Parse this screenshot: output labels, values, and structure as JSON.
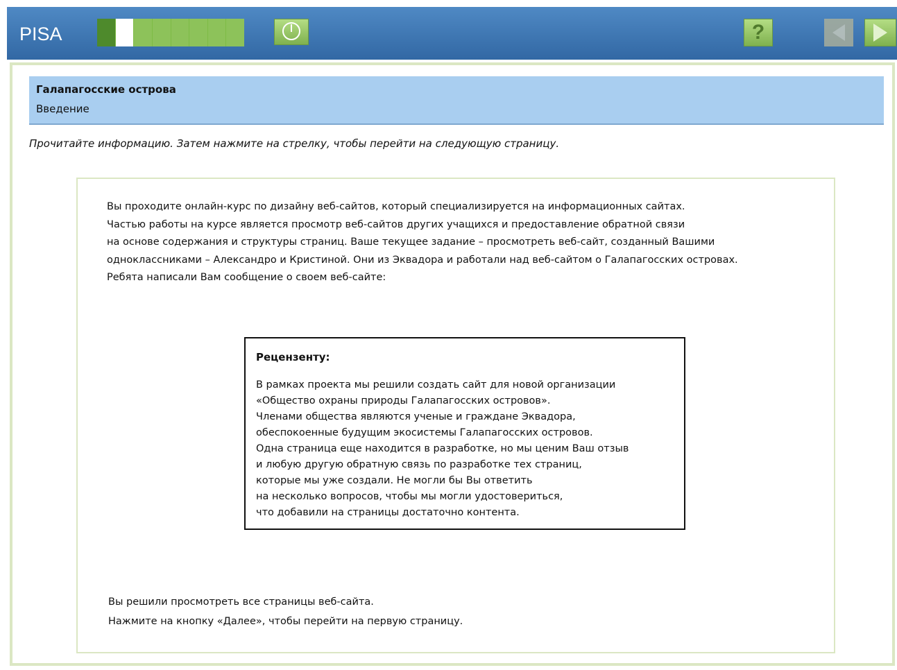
{
  "topbar": {
    "app_title": "PISA",
    "progress": {
      "total_segments": 8,
      "done_segments": 1,
      "current_segment": 2
    },
    "help_label": "?"
  },
  "header": {
    "unit_title": "Галапагосские острова",
    "unit_subtitle": "Введение"
  },
  "instruction": "Прочитайте информацию. Затем нажмите на стрелку, чтобы перейти на следующую страницу.",
  "intro_lines": [
    "Вы проходите онлайн-курс по дизайну веб-сайтов, который специализируется на информационных сайтах.",
    "Частью работы на курсе является просмотр веб-сайтов других учащихся и предоставление обратной связи",
    "на основе содержания и структуры страниц. Ваше текущее задание – просмотреть веб-сайт, созданный Вашими",
    "одноклассниками – Александро и Кристиной. Они из Эквадора и работали над веб-сайтом о Галапагосских островах.",
    "Ребята написали Вам сообщение о своем веб-сайте:"
  ],
  "message": {
    "heading": "Рецензенту:",
    "lines": [
      "В рамках проекта мы решили создать сайт для новой организации",
      "«Общество охраны природы Галапагосских островов».",
      "Членами общества являются ученые и граждане Эквадора,",
      "обеспокоенные будущим экосистемы Галапагосских островов.",
      "Одна страница еще находится в разработке, но мы ценим Ваш отзыв",
      "и любую другую обратную связь по разработке тех страниц,",
      "которые мы уже создали. Не могли бы Вы ответить",
      "на несколько вопросов, чтобы мы могли удостовериться,",
      "что добавили на страницы достаточно контента."
    ]
  },
  "outro_lines": [
    "Вы решили просмотреть все страницы веб-сайта.",
    "Нажмите на кнопку «Далее», чтобы перейти на первую страницу."
  ],
  "icons": {
    "timer": "clock-icon",
    "help": "help-icon",
    "prev": "arrow-left-icon",
    "next": "arrow-right-icon"
  },
  "colors": {
    "topbar": "#3f78b5",
    "accent_green": "#8dc25a",
    "header_box": "#a9cef0",
    "frame": "#dbe7c3"
  }
}
